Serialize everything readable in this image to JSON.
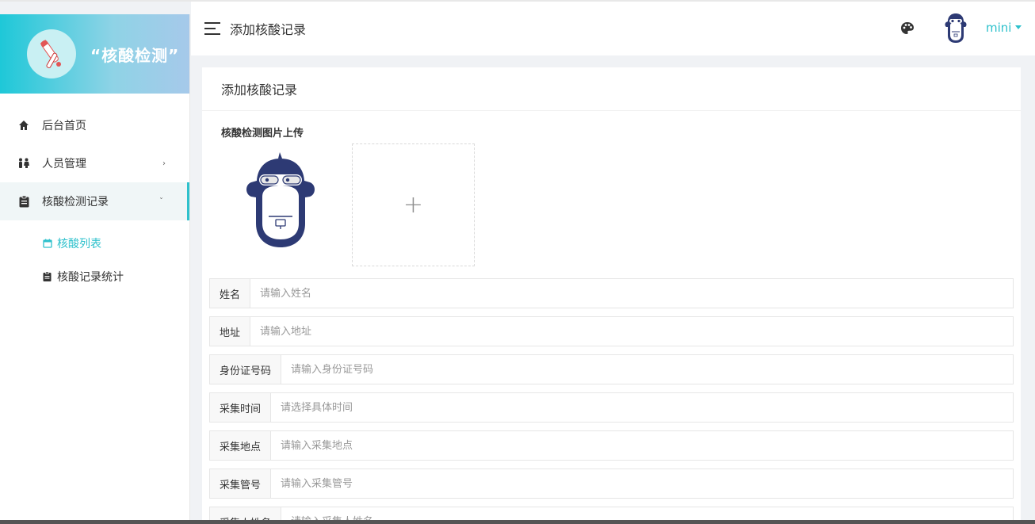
{
  "brand": {
    "title": "“核酸检测”"
  },
  "sidebar": {
    "items": [
      {
        "label": "后台首页",
        "icon": "home-icon",
        "arrow": ""
      },
      {
        "label": "人员管理",
        "icon": "people-icon",
        "arrow": "›"
      },
      {
        "label": "核酸检测记录",
        "icon": "clipboard-icon",
        "arrow": "ˇ"
      }
    ],
    "sub_items": [
      {
        "label": "核酸列表",
        "icon": "calendar-icon"
      },
      {
        "label": "核酸记录统计",
        "icon": "clipboard-icon"
      }
    ]
  },
  "header": {
    "title": "添加核酸记录",
    "user_name": "mini"
  },
  "card": {
    "title": "添加核酸记录",
    "upload_label": "核酸检测图片上传",
    "upload_plus": "+"
  },
  "form": {
    "fields": [
      {
        "label": "姓名",
        "placeholder": "请输入姓名"
      },
      {
        "label": "地址",
        "placeholder": "请输入地址"
      },
      {
        "label": "身份证号码",
        "placeholder": "请输入身份证号码"
      },
      {
        "label": "采集时间",
        "placeholder": "请选择具体时间"
      },
      {
        "label": "采集地点",
        "placeholder": "请输入采集地点"
      },
      {
        "label": "采集管号",
        "placeholder": "请输入采集管号"
      },
      {
        "label": "采集人姓名",
        "placeholder": "请输入采集人姓名"
      }
    ]
  },
  "colors": {
    "accent": "#2ec1cc",
    "brand_gradient_start": "#1ec8d8",
    "brand_gradient_end": "#a6c9ea",
    "mascot": "#2d3a74"
  }
}
